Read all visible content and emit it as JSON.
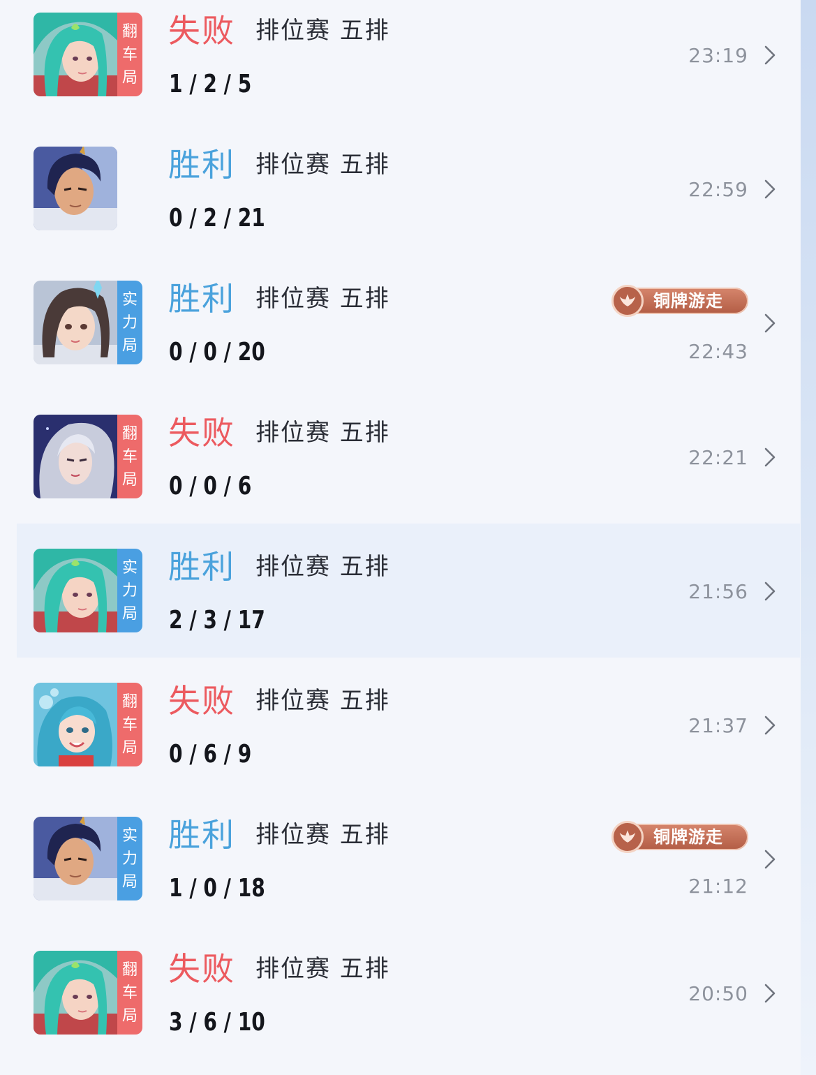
{
  "colors": {
    "win": "#4aa2dc",
    "loss": "#ec5a5f",
    "tag_red": "#ee6b6b",
    "tag_blue": "#4a9fe2",
    "badge": "#c2705a"
  },
  "matches": [
    {
      "result": "失败",
      "mode": "排位赛 五排",
      "kda": "1 / 2 / 5",
      "time": "23:19",
      "tag": [
        "翻",
        "车",
        "局"
      ],
      "hero_icon": "teal-hair-hero-portrait",
      "badge": null
    },
    {
      "result": "胜利",
      "mode": "排位赛 五排",
      "kda": "0 / 2 / 21",
      "time": "22:59",
      "tag": null,
      "hero_icon": "dark-hair-male-hero-portrait",
      "badge": null
    },
    {
      "result": "胜利",
      "mode": "排位赛 五排",
      "kda": "0 / 0 / 20",
      "time": "22:43",
      "tag": [
        "实",
        "力",
        "局"
      ],
      "hero_icon": "brown-hair-hero-portrait",
      "badge": "铜牌游走"
    },
    {
      "result": "失败",
      "mode": "排位赛 五排",
      "kda": "0 / 0 / 6",
      "time": "22:21",
      "tag": [
        "翻",
        "车",
        "局"
      ],
      "hero_icon": "silver-hair-hero-portrait",
      "badge": null
    },
    {
      "result": "胜利",
      "mode": "排位赛 五排",
      "kda": "2 / 3 / 17",
      "time": "21:56",
      "tag": [
        "实",
        "力",
        "局"
      ],
      "hero_icon": "teal-hair-hero-portrait",
      "badge": null
    },
    {
      "result": "失败",
      "mode": "排位赛 五排",
      "kda": "0 / 6 / 9",
      "time": "21:37",
      "tag": [
        "翻",
        "车",
        "局"
      ],
      "hero_icon": "aqua-hair-hero-portrait",
      "badge": null
    },
    {
      "result": "胜利",
      "mode": "排位赛 五排",
      "kda": "1 / 0 / 18",
      "time": "21:12",
      "tag": [
        "实",
        "力",
        "局"
      ],
      "hero_icon": "dark-hair-male-hero-portrait",
      "badge": "铜牌游走"
    },
    {
      "result": "失败",
      "mode": "排位赛 五排",
      "kda": "3 / 6 / 10",
      "time": "20:50",
      "tag": [
        "翻",
        "车",
        "局"
      ],
      "hero_icon": "teal-hair-hero-portrait",
      "badge": null
    }
  ]
}
